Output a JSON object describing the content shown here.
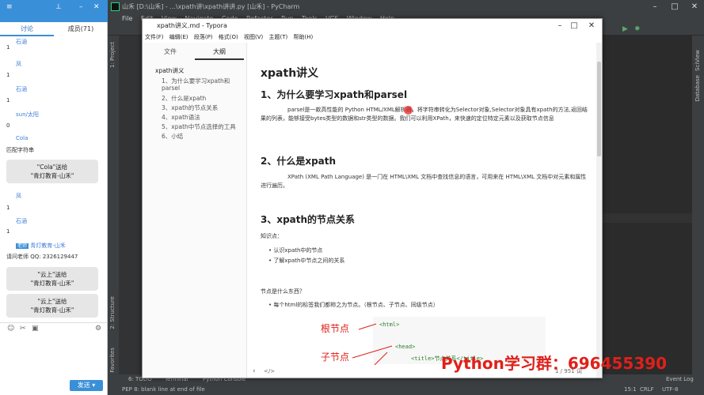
{
  "pycharm": {
    "title": "山禾 [D:\\山禾] - ...\\xpath讲\\xpath讲讲.py [山禾] - PyCharm",
    "menu": "File Edit View Navigate Code Refactor Run Tools VCS Window Help",
    "project_tab": "1: Project",
    "structure_tab": "2: Structure",
    "favorites_tab": "2: Favorites",
    "scview_tab": "SciView",
    "database_tab": "Database",
    "bottom_todo": "6: TODO",
    "bottom_terminal": "Terminal",
    "bottom_console": "Python Console",
    "event_log": "Event Log",
    "status_msg": "PEP 8: blank line at end of file",
    "status_pos": "15:1",
    "status_crlf": "CRLF",
    "status_enc": "UTF-8"
  },
  "chat": {
    "tab_discuss": "讨论",
    "tab_members": "成员(71)",
    "messages": [
      {
        "nick": "石涵",
        "text": "1"
      },
      {
        "nick": "凤",
        "text": "1"
      },
      {
        "nick": "石涵",
        "text": "1"
      },
      {
        "nick": "sun/太阳",
        "text": "0"
      },
      {
        "nick": "Cola",
        "text": "匹配字符串"
      }
    ],
    "gift1_a": "\"Cola\"送给",
    "gift1_b": "\"青灯教育-山禾\"",
    "msg6_nick": "凤",
    "msg6_text": "1",
    "msg7_nick": "石涵",
    "msg7_text": "1",
    "teacher_badge": "老师",
    "teacher_nick": "青灯教育-山禾",
    "teacher_text": "请问老师 QQ: 2326129447",
    "gift2_a": "\"云上\"送给",
    "gift2_b": "\"青灯教育-山禾\"",
    "gift3_a": "\"云上\"送给",
    "gift3_b": "\"青灯教育-山禾\"",
    "send": "发送"
  },
  "typora": {
    "title": "xpath讲义.md - Typora",
    "menu": [
      "文件(F)",
      "编辑(E)",
      "段落(P)",
      "格式(O)",
      "视图(V)",
      "主题(T)",
      "帮助(H)"
    ],
    "tab_files": "文件",
    "tab_outline": "大纲",
    "outline": [
      "xpath讲义",
      "1、为什么要学习xpath和parsel",
      "2、什么是xpath",
      "3、xpath的节点关系",
      "4、xpath语法",
      "5、xpath中节点选择的工具",
      "6、小结"
    ],
    "h1": "xpath讲义",
    "s1_title": "1、为什么要学习xpath和parsel",
    "s1_body": "parsel是一款高性能的 Python HTML/XML解析器，将字符串转化为Selector对象,Selector对象具有xpath的方法,返回结果的列表，能够接受bytes类型的数据和str类型的数据。我们可以利用XPath，来快速的定位特定元素以及获取节点信息",
    "s2_title": "2、什么是xpath",
    "s2_body": "XPath (XML Path Language) 是一门在 HTML\\XML 文档中查找信息的语言，可用来在 HTML\\XML 文档中对元素和属性进行遍历。",
    "s3_title": "3、xpath的节点关系",
    "knowledge": "知识点：",
    "k1": "认识xpath中的节点",
    "k2": "了解xpath中节点之间的关系",
    "q": "节点是什么东西？",
    "q1": "每个html的标签我们都称之为节点。（根节点、子节点、同级节点）",
    "code1": "<html>",
    "code2": "<head>",
    "code3": "<title>节点关系</title>",
    "anno_root": "根节点",
    "anno_child": "子节点",
    "foot_count": "1 / 951 词"
  },
  "watermark": "Python学习群：696455390"
}
